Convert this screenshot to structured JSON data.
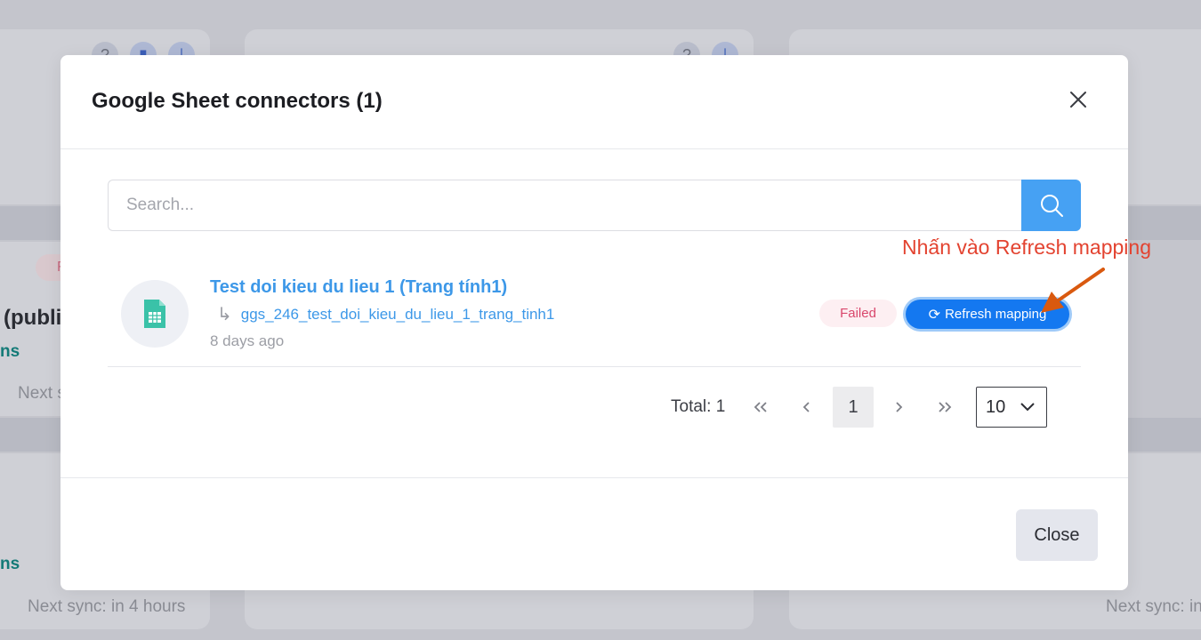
{
  "background": {
    "card1_title_fragment": "(publi",
    "card1_teal_fragment": "ns",
    "card1_next_fragment": "Next s",
    "card1_pill_fragment": "F",
    "card2_teal_fragment": "ns",
    "card2_next": "Next sync: in 4 hours",
    "card3_next_fragment": "Next sync: in"
  },
  "modal": {
    "title": "Google Sheet connectors (1)",
    "search": {
      "placeholder": "Search..."
    },
    "connector": {
      "name": "Test doi kieu du lieu 1 (Trang tính1)",
      "table_name": "ggs_246_test_doi_kieu_du_lieu_1_trang_tinh1",
      "updated": "8 days ago",
      "status": "Failed",
      "refresh_label": "Refresh mapping"
    },
    "pagination": {
      "total_label": "Total: 1",
      "current_page": "1",
      "page_size": "10"
    },
    "footer": {
      "close_label": "Close"
    }
  },
  "annotation": {
    "text": "Nhấn vào Refresh mapping"
  },
  "colors": {
    "primary": "#1478f0",
    "link": "#3d98e8",
    "failed_text": "#d9476c",
    "annotation": "#e34330"
  }
}
